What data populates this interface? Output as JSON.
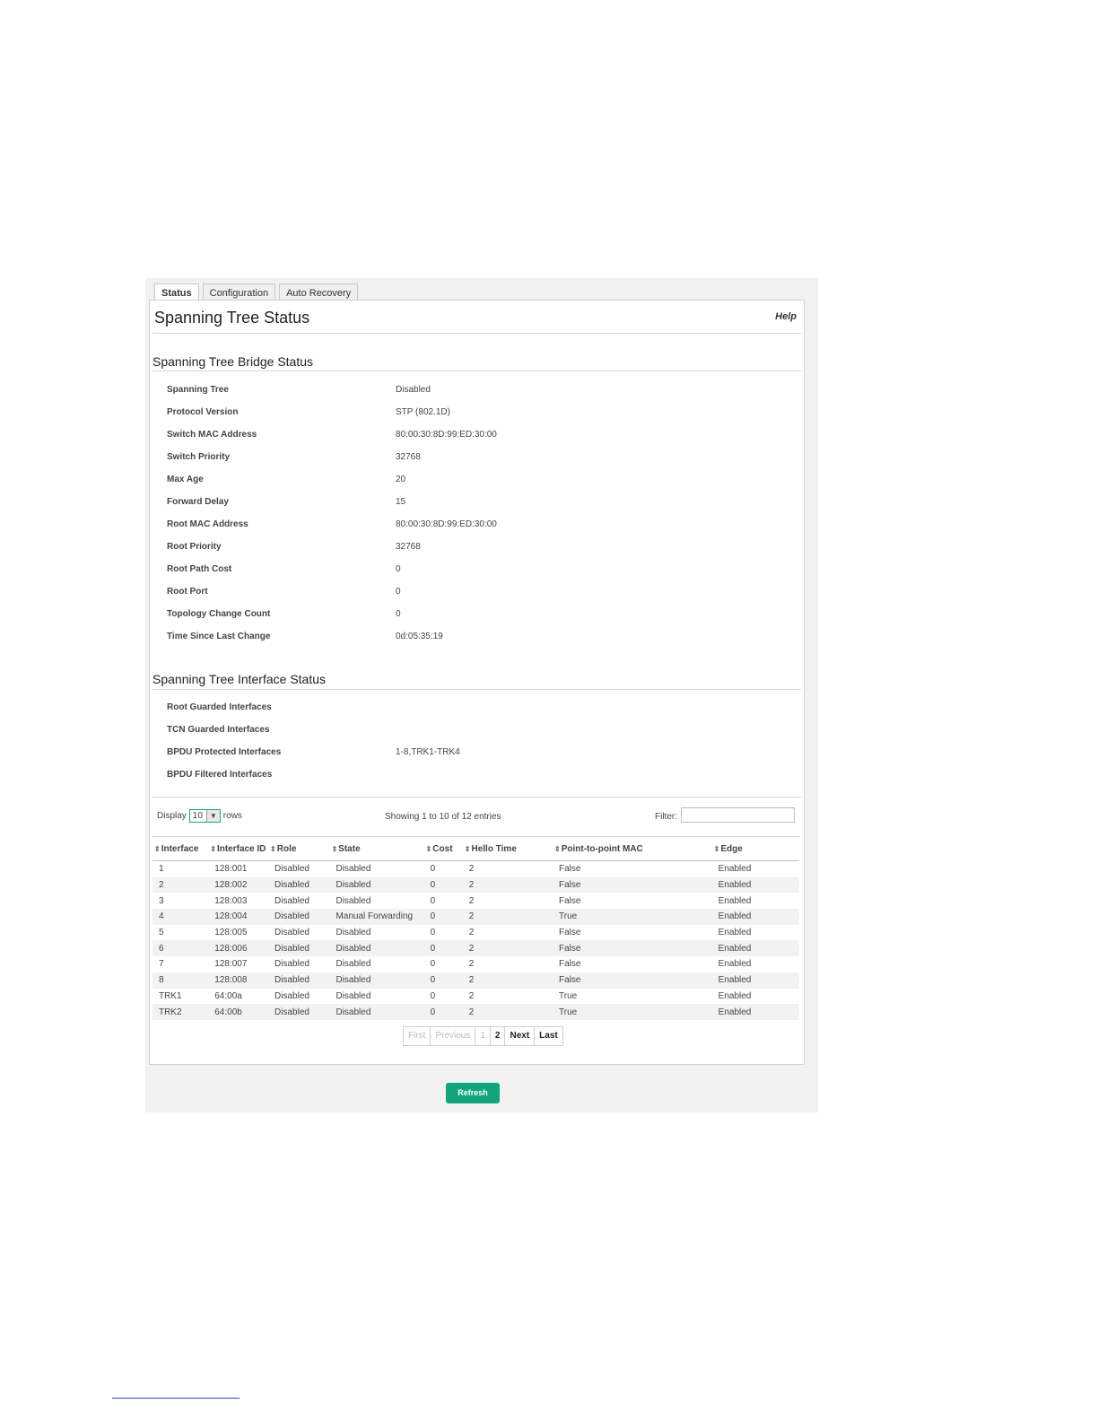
{
  "tabs": [
    {
      "label": "Status",
      "active": true
    },
    {
      "label": "Configuration",
      "active": false
    },
    {
      "label": "Auto Recovery",
      "active": false
    }
  ],
  "page": {
    "title": "Spanning Tree Status",
    "help": "Help"
  },
  "bridge_status": {
    "title": "Spanning Tree Bridge Status",
    "rows": [
      {
        "label": "Spanning Tree",
        "value": "Disabled"
      },
      {
        "label": "Protocol Version",
        "value": "STP (802.1D)"
      },
      {
        "label": "Switch MAC Address",
        "value": "80:00:30:8D:99:ED:30:00"
      },
      {
        "label": "Switch Priority",
        "value": "32768"
      },
      {
        "label": "Max Age",
        "value": "20"
      },
      {
        "label": "Forward Delay",
        "value": "15"
      },
      {
        "label": "Root MAC Address",
        "value": "80:00:30:8D:99:ED:30:00"
      },
      {
        "label": "Root Priority",
        "value": "32768"
      },
      {
        "label": "Root Path Cost",
        "value": "0"
      },
      {
        "label": "Root Port",
        "value": "0"
      },
      {
        "label": "Topology Change Count",
        "value": "0"
      },
      {
        "label": "Time Since Last Change",
        "value": "0d:05:35:19"
      }
    ]
  },
  "interface_status": {
    "title": "Spanning Tree Interface Status",
    "rows": [
      {
        "label": "Root Guarded Interfaces",
        "value": ""
      },
      {
        "label": "TCN Guarded Interfaces",
        "value": ""
      },
      {
        "label": "BPDU Protected Interfaces",
        "value": "1-8,TRK1-TRK4"
      },
      {
        "label": "BPDU Filtered Interfaces",
        "value": ""
      }
    ]
  },
  "table_controls": {
    "display_prefix": "Display",
    "display_value": "10",
    "display_suffix": "rows",
    "showing": "Showing 1 to 10 of 12 entries",
    "filter_label": "Filter:",
    "filter_value": ""
  },
  "table": {
    "columns": [
      "Interface",
      "Interface ID",
      "Role",
      "State",
      "Cost",
      "Hello Time",
      "Point-to-point MAC",
      "Edge"
    ],
    "rows": [
      [
        "1",
        "128:001",
        "Disabled",
        "Disabled",
        "0",
        "2",
        "False",
        "Enabled"
      ],
      [
        "2",
        "128:002",
        "Disabled",
        "Disabled",
        "0",
        "2",
        "False",
        "Enabled"
      ],
      [
        "3",
        "128:003",
        "Disabled",
        "Disabled",
        "0",
        "2",
        "False",
        "Enabled"
      ],
      [
        "4",
        "128:004",
        "Disabled",
        "Manual Forwarding",
        "0",
        "2",
        "True",
        "Enabled"
      ],
      [
        "5",
        "128:005",
        "Disabled",
        "Disabled",
        "0",
        "2",
        "False",
        "Enabled"
      ],
      [
        "6",
        "128:006",
        "Disabled",
        "Disabled",
        "0",
        "2",
        "False",
        "Enabled"
      ],
      [
        "7",
        "128:007",
        "Disabled",
        "Disabled",
        "0",
        "2",
        "False",
        "Enabled"
      ],
      [
        "8",
        "128:008",
        "Disabled",
        "Disabled",
        "0",
        "2",
        "False",
        "Enabled"
      ],
      [
        "TRK1",
        "64:00a",
        "Disabled",
        "Disabled",
        "0",
        "2",
        "True",
        "Enabled"
      ],
      [
        "TRK2",
        "64:00b",
        "Disabled",
        "Disabled",
        "0",
        "2",
        "True",
        "Enabled"
      ]
    ]
  },
  "pagination": {
    "first": "First",
    "previous": "Previous",
    "pages": [
      "1",
      "2"
    ],
    "current_page": "1",
    "next": "Next",
    "last": "Last"
  },
  "refresh_label": "Refresh",
  "colors": {
    "accent": "#12a47c",
    "select_border": "#1aa37a",
    "frame_bg": "#f1f1f1",
    "row_alt": "#f2f2f2"
  }
}
